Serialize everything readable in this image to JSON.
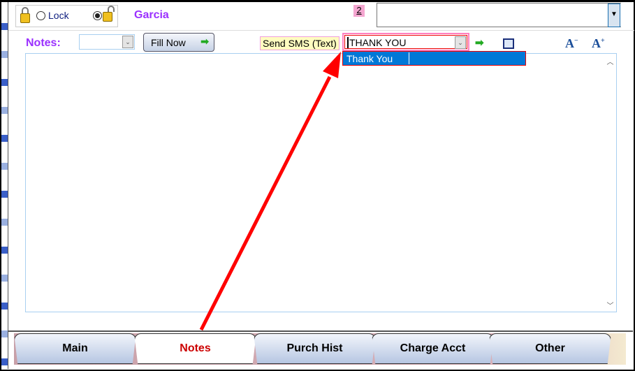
{
  "header": {
    "lock_label": "Lock",
    "lock_selected": "unlocked",
    "customer_name": "Garcia",
    "count_badge": "2",
    "top_combo_value": ""
  },
  "notes_row": {
    "notes_label": "Notes:",
    "notes_select_value": "",
    "fill_now_label": "Fill Now",
    "sms_label": "Send SMS (Text)",
    "sms_value": "THANK YOU",
    "sms_dropdown_options": [
      "Thank You"
    ]
  },
  "notes_text": "",
  "tabs": [
    {
      "label": "Main"
    },
    {
      "label": "Notes",
      "active": true
    },
    {
      "label": "Purch Hist"
    },
    {
      "label": "Charge Acct"
    },
    {
      "label": "Other"
    }
  ],
  "annotation": {
    "arrow_color": "#ff0000"
  }
}
